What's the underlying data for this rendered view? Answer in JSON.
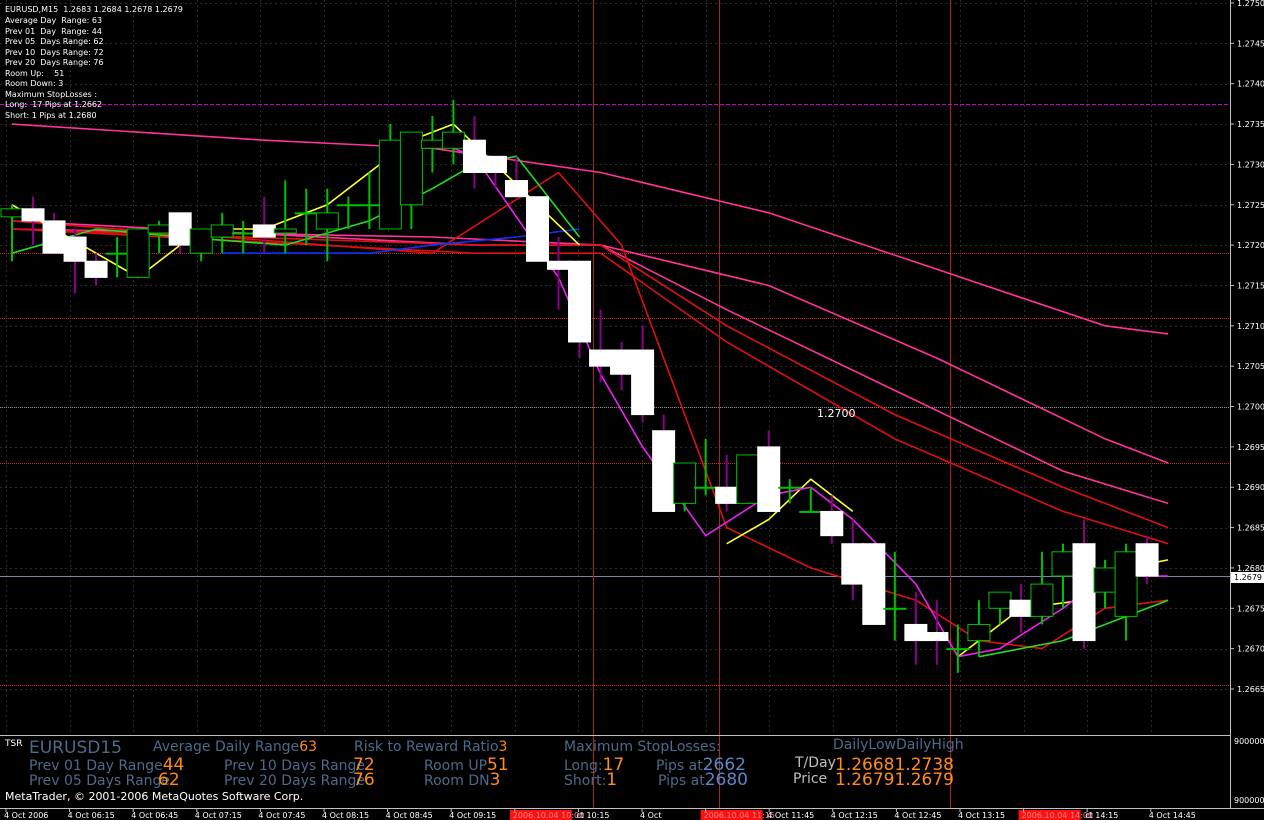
{
  "window": {
    "header": "EURUSD,M15  1.2683 1.2684 1.2678 1.2679",
    "info_lines": [
      "Average Day  Range: 63",
      "Prev 01  Day  Range: 44",
      "Prev 05  Days Range: 62",
      "Prev 10  Days Range: 72",
      "Prev 20  Days Range: 76",
      "Room Up:    51",
      "Room Down: 3",
      "Maximum StopLosses :",
      "Long:  17 Pips at 1.2662",
      "Short: 1 Pips at 1.2680"
    ],
    "copyright": "MetaTrader, © 2001-2006 MetaQuotes Software Corp.",
    "price_label": "1.2700",
    "current_price": "1.2679"
  },
  "indicator_panel": {
    "name": "TSR",
    "symbol": "EURUSD",
    "period": "15",
    "avg_daily_range_label": "Average Daily Range",
    "avg_daily_range_value": "63",
    "risk_reward_label": "Risk to Reward Ratio",
    "risk_reward_value": "3",
    "max_stoplosses_label": "Maximum StopLosses:",
    "daily_low_label": "DailyLow",
    "daily_high_label": "DailyHigh",
    "prev01_label": "Prev 01 Day Range",
    "prev01_value": "44",
    "prev10_label": "Prev 10 Days Range",
    "prev10_value": "72",
    "room_up_label": "Room UP",
    "room_up_value": "51",
    "long_label": "Long:",
    "long_value": "17",
    "pips_at_label": "Pips at",
    "long_pips_at": "2662",
    "tday_label": "T/Day",
    "tday_low": "1.2668",
    "tday_high": "1.2738",
    "prev05_label": "Prev 05 Days Range",
    "prev05_value": "62",
    "prev20_label": "Prev 20 Days Range",
    "prev20_value": "76",
    "room_dn_label": "Room DN",
    "room_dn_value": "3",
    "short_label": "Short:",
    "short_value": "1",
    "short_pips_at": "2680",
    "price_label": "Price",
    "price_value": "1.2679",
    "price_value2": "1.2679",
    "yaxis_top": "900000",
    "yaxis_bottom": "900000"
  },
  "colors": {
    "background": "#000000",
    "grid": "#2a2a2a",
    "bull_candle": "#00c000",
    "bear_candle": "#ffffff",
    "wick_dn": "#8b008b",
    "label_orange": "#ff8c1a",
    "label_steel": "#4d6a8a",
    "label_blue": "#5b87c7"
  },
  "chart_data": {
    "type": "candlestick",
    "symbol": "EURUSD",
    "timeframe": "M15",
    "ylim": [
      1.2662,
      1.275
    ],
    "y_ticks": [
      "1.2750",
      "1.2745",
      "1.2740",
      "1.2735",
      "1.2730",
      "1.2725",
      "1.2720",
      "1.2715",
      "1.2710",
      "1.2705",
      "1.2700",
      "1.2695",
      "1.2690",
      "1.2685",
      "1.2680",
      "1.2675",
      "1.2670",
      "1.2665"
    ],
    "x_labels": [
      "4 Oct 2006",
      "4 Oct 06:15",
      "4 Oct 06:45",
      "4 Oct 07:15",
      "4 Oct 07:45",
      "4 Oct 08:15",
      "4 Oct 08:45",
      "4 Oct 09:15",
      "2006.10.04 10:00",
      "ct 10:15",
      "4 Oct",
      "2006.10.04 11:15",
      "4 Oct 11:45",
      "4 Oct 12:15",
      "4 Oct 12:45",
      "4 Oct 13:15",
      "2006.10.04 14:00",
      "ct 14:15",
      "4 Oct 14:45"
    ],
    "highlighted_x_labels": [
      8,
      11,
      16
    ],
    "candles": [
      {
        "o": 1.27235,
        "h": 1.2725,
        "l": 1.2718,
        "c": 1.27245
      },
      {
        "o": 1.27245,
        "h": 1.2726,
        "l": 1.272,
        "c": 1.2723
      },
      {
        "o": 1.2723,
        "h": 1.2724,
        "l": 1.2719,
        "c": 1.2719
      },
      {
        "o": 1.2721,
        "h": 1.2722,
        "l": 1.2714,
        "c": 1.2718
      },
      {
        "o": 1.2718,
        "h": 1.2719,
        "l": 1.2715,
        "c": 1.2716
      },
      {
        "o": 1.2719,
        "h": 1.2721,
        "l": 1.2716,
        "c": 1.2719
      },
      {
        "o": 1.2716,
        "h": 1.2722,
        "l": 1.2716,
        "c": 1.2722
      },
      {
        "o": 1.27215,
        "h": 1.2723,
        "l": 1.2719,
        "c": 1.27225
      },
      {
        "o": 1.2724,
        "h": 1.2724,
        "l": 1.2719,
        "c": 1.272
      },
      {
        "o": 1.2719,
        "h": 1.2722,
        "l": 1.2718,
        "c": 1.2722
      },
      {
        "o": 1.2721,
        "h": 1.2724,
        "l": 1.2719,
        "c": 1.27225
      },
      {
        "o": 1.27215,
        "h": 1.2723,
        "l": 1.2719,
        "c": 1.27215
      },
      {
        "o": 1.27225,
        "h": 1.2726,
        "l": 1.2719,
        "c": 1.2721
      },
      {
        "o": 1.27215,
        "h": 1.2728,
        "l": 1.2719,
        "c": 1.2722
      },
      {
        "o": 1.2724,
        "h": 1.2727,
        "l": 1.272,
        "c": 1.2724
      },
      {
        "o": 1.2722,
        "h": 1.2727,
        "l": 1.2718,
        "c": 1.2724
      },
      {
        "o": 1.2725,
        "h": 1.2726,
        "l": 1.2722,
        "c": 1.2725
      },
      {
        "o": 1.2725,
        "h": 1.2729,
        "l": 1.2722,
        "c": 1.2725
      },
      {
        "o": 1.2722,
        "h": 1.2735,
        "l": 1.2722,
        "c": 1.2733
      },
      {
        "o": 1.2725,
        "h": 1.2734,
        "l": 1.2722,
        "c": 1.2734
      },
      {
        "o": 1.2732,
        "h": 1.2736,
        "l": 1.2729,
        "c": 1.2733
      },
      {
        "o": 1.2732,
        "h": 1.2738,
        "l": 1.273,
        "c": 1.2734
      },
      {
        "o": 1.2733,
        "h": 1.2736,
        "l": 1.2727,
        "c": 1.2729
      },
      {
        "o": 1.2731,
        "h": 1.2731,
        "l": 1.2727,
        "c": 1.2729
      },
      {
        "o": 1.2728,
        "h": 1.2731,
        "l": 1.2726,
        "c": 1.2726
      },
      {
        "o": 1.2726,
        "h": 1.2726,
        "l": 1.2718,
        "c": 1.2718
      },
      {
        "o": 1.2718,
        "h": 1.2721,
        "l": 1.2712,
        "c": 1.2717
      },
      {
        "o": 1.2718,
        "h": 1.2718,
        "l": 1.2706,
        "c": 1.2708
      },
      {
        "o": 1.2707,
        "h": 1.2712,
        "l": 1.2703,
        "c": 1.2705
      },
      {
        "o": 1.2707,
        "h": 1.2708,
        "l": 1.2702,
        "c": 1.2704
      },
      {
        "o": 1.2707,
        "h": 1.271,
        "l": 1.2698,
        "c": 1.2699
      },
      {
        "o": 1.2697,
        "h": 1.2699,
        "l": 1.2687,
        "c": 1.2687
      },
      {
        "o": 1.2688,
        "h": 1.2693,
        "l": 1.2687,
        "c": 1.2693
      },
      {
        "o": 1.269,
        "h": 1.2696,
        "l": 1.2689,
        "c": 1.269
      },
      {
        "o": 1.269,
        "h": 1.2694,
        "l": 1.2687,
        "c": 1.2688
      },
      {
        "o": 1.2688,
        "h": 1.2694,
        "l": 1.2688,
        "c": 1.2694
      },
      {
        "o": 1.2695,
        "h": 1.2697,
        "l": 1.2687,
        "c": 1.2687
      },
      {
        "o": 1.269,
        "h": 1.2691,
        "l": 1.2688,
        "c": 1.269
      },
      {
        "o": 1.2687,
        "h": 1.269,
        "l": 1.2687,
        "c": 1.2687
      },
      {
        "o": 1.2687,
        "h": 1.2689,
        "l": 1.2683,
        "c": 1.2684
      },
      {
        "o": 1.2683,
        "h": 1.2686,
        "l": 1.2676,
        "c": 1.2678
      },
      {
        "o": 1.2683,
        "h": 1.2683,
        "l": 1.2673,
        "c": 1.2673
      },
      {
        "o": 1.2675,
        "h": 1.2682,
        "l": 1.2671,
        "c": 1.2675
      },
      {
        "o": 1.2673,
        "h": 1.2677,
        "l": 1.2668,
        "c": 1.2671
      },
      {
        "o": 1.2672,
        "h": 1.2676,
        "l": 1.2668,
        "c": 1.2671
      },
      {
        "o": 1.267,
        "h": 1.2673,
        "l": 1.2667,
        "c": 1.267
      },
      {
        "o": 1.2671,
        "h": 1.2676,
        "l": 1.2669,
        "c": 1.2673
      },
      {
        "o": 1.2675,
        "h": 1.2677,
        "l": 1.2673,
        "c": 1.2677
      },
      {
        "o": 1.2676,
        "h": 1.2678,
        "l": 1.2672,
        "c": 1.2674
      },
      {
        "o": 1.2674,
        "h": 1.2682,
        "l": 1.2673,
        "c": 1.2678
      },
      {
        "o": 1.2679,
        "h": 1.2683,
        "l": 1.2675,
        "c": 1.2682
      },
      {
        "o": 1.2683,
        "h": 1.2686,
        "l": 1.267,
        "c": 1.2671
      },
      {
        "o": 1.2677,
        "h": 1.2681,
        "l": 1.2675,
        "c": 1.268
      },
      {
        "o": 1.2674,
        "h": 1.2683,
        "l": 1.2671,
        "c": 1.2682
      },
      {
        "o": 1.2683,
        "h": 1.2684,
        "l": 1.2678,
        "c": 1.2679
      }
    ],
    "series": [
      {
        "color": "#ff3399",
        "values": [
          [
            0,
            1.2735
          ],
          [
            12,
            1.2733
          ],
          [
            20,
            1.2732
          ],
          [
            28,
            1.2729
          ],
          [
            36,
            1.2724
          ],
          [
            44,
            1.2717
          ],
          [
            52,
            1.271
          ],
          [
            55,
            1.2709
          ]
        ]
      },
      {
        "color": "#ff3399",
        "values": [
          [
            0,
            1.2722
          ],
          [
            20,
            1.2721
          ],
          [
            28,
            1.272
          ],
          [
            36,
            1.2715
          ],
          [
            44,
            1.2706
          ],
          [
            52,
            1.2696
          ],
          [
            55,
            1.2693
          ]
        ]
      },
      {
        "color": "#ff3399",
        "values": [
          [
            0,
            1.2723
          ],
          [
            22,
            1.272
          ],
          [
            28,
            1.272
          ],
          [
            34,
            1.2712
          ],
          [
            42,
            1.2702
          ],
          [
            50,
            1.2692
          ],
          [
            55,
            1.2688
          ]
        ]
      },
      {
        "color": "#dd1111",
        "values": [
          [
            0,
            1.2722
          ],
          [
            22,
            1.272
          ],
          [
            28,
            1.272
          ],
          [
            34,
            1.271
          ],
          [
            42,
            1.2699
          ],
          [
            50,
            1.269
          ],
          [
            55,
            1.2685
          ]
        ]
      },
      {
        "color": "#dd1111",
        "values": [
          [
            0,
            1.2722
          ],
          [
            22,
            1.2719
          ],
          [
            28,
            1.2719
          ],
          [
            34,
            1.2708
          ],
          [
            42,
            1.2696
          ],
          [
            50,
            1.2687
          ],
          [
            55,
            1.2683
          ]
        ]
      },
      {
        "color": "#dd1111",
        "values": [
          [
            0,
            1.2723
          ],
          [
            20,
            1.2719
          ],
          [
            26,
            1.2729
          ],
          [
            29,
            1.272
          ],
          [
            34,
            1.2685
          ],
          [
            38,
            1.268
          ],
          [
            43,
            1.2676
          ],
          [
            46,
            1.2671
          ],
          [
            49,
            1.267
          ],
          [
            52,
            1.2675
          ],
          [
            55,
            1.2676
          ]
        ]
      },
      {
        "color": "#1030ff",
        "values": [
          [
            10,
            1.2719
          ],
          [
            17,
            1.2719
          ],
          [
            20,
            1.272
          ],
          [
            24,
            1.2721
          ],
          [
            27,
            1.2722
          ]
        ]
      },
      {
        "color": "#22dd22",
        "values": [
          [
            0,
            1.2719
          ],
          [
            4,
            1.2722
          ],
          [
            8,
            1.2721
          ],
          [
            13,
            1.272
          ],
          [
            17,
            1.2723
          ],
          [
            20,
            1.2727
          ],
          [
            22,
            1.273
          ],
          [
            24,
            1.2731
          ],
          [
            27,
            1.2721
          ]
        ]
      },
      {
        "color": "#22dd22",
        "values": [
          [
            46,
            1.2669
          ],
          [
            50,
            1.2671
          ],
          [
            53,
            1.2674
          ],
          [
            55,
            1.2676
          ]
        ]
      },
      {
        "color": "#ffff33",
        "values": [
          [
            0,
            1.2725
          ],
          [
            4,
            1.2719
          ],
          [
            6,
            1.2716
          ],
          [
            8,
            1.272
          ],
          [
            10,
            1.2722
          ],
          [
            12,
            1.2722
          ],
          [
            15,
            1.2725
          ],
          [
            19,
            1.2733
          ],
          [
            21,
            1.2735
          ],
          [
            23,
            1.273
          ],
          [
            27,
            1.272
          ]
        ]
      },
      {
        "color": "#ffff33",
        "values": [
          [
            34,
            1.2683
          ],
          [
            36,
            1.2686
          ],
          [
            38,
            1.2691
          ],
          [
            40,
            1.2687
          ]
        ]
      },
      {
        "color": "#ffff33",
        "values": [
          [
            45,
            1.2669
          ],
          [
            48,
            1.2675
          ],
          [
            51,
            1.2676
          ],
          [
            53,
            1.268
          ],
          [
            55,
            1.2681
          ]
        ]
      },
      {
        "color": "#ee22ee",
        "values": [
          [
            20,
            1.2733
          ],
          [
            22,
            1.2731
          ],
          [
            26,
            1.2716
          ],
          [
            28,
            1.2704
          ],
          [
            30,
            1.2695
          ],
          [
            33,
            1.2684
          ],
          [
            36,
            1.2689
          ],
          [
            38,
            1.269
          ],
          [
            40,
            1.2686
          ],
          [
            43,
            1.2678
          ],
          [
            45,
            1.2669
          ],
          [
            47,
            1.267
          ],
          [
            50,
            1.2675
          ],
          [
            52,
            1.2679
          ],
          [
            55,
            1.2679
          ]
        ]
      }
    ],
    "h_lines": [
      {
        "value": 1.27375,
        "color": "#cc00cc",
        "style": "dashed"
      },
      {
        "value": 1.2719,
        "color": "#dd2222",
        "style": "dotted"
      },
      {
        "value": 1.2711,
        "color": "#dd2222",
        "style": "dotted"
      },
      {
        "value": 1.27,
        "color": "#888888",
        "style": "dotted"
      },
      {
        "value": 1.2693,
        "color": "#dd2222",
        "style": "dotted"
      },
      {
        "value": 1.2679,
        "color": "#8080aa",
        "style": "solid"
      },
      {
        "value": 1.26655,
        "color": "#dd2222",
        "style": "dotted"
      }
    ],
    "v_lines": [
      {
        "at_candle": 28,
        "color": "#aa2222"
      },
      {
        "at_candle": 34,
        "color": "#aa2222"
      },
      {
        "at_candle": 45,
        "color": "#aa2222"
      }
    ]
  }
}
